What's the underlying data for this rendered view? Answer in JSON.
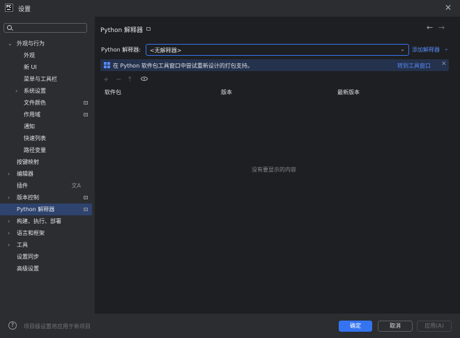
{
  "window": {
    "title": "设置",
    "app_icon_text": "PC"
  },
  "search": {
    "placeholder": "",
    "value": ""
  },
  "sidebar": {
    "items": [
      {
        "label": "外观与行为",
        "expanded": true
      },
      {
        "label": "外观"
      },
      {
        "label": "新 UI"
      },
      {
        "label": "菜单与工具栏"
      },
      {
        "label": "系统设置",
        "expandable": true
      },
      {
        "label": "文件颜色"
      },
      {
        "label": "作用域"
      },
      {
        "label": "通知"
      },
      {
        "label": "快速列表"
      },
      {
        "label": "路径变量"
      },
      {
        "label": "按键映射"
      },
      {
        "label": "编辑器",
        "expandable": true
      },
      {
        "label": "插件"
      },
      {
        "label": "版本控制",
        "expandable": true
      },
      {
        "label": "Python 解释器",
        "selected": true
      },
      {
        "label": "构建、执行、部署",
        "expandable": true
      },
      {
        "label": "语言和框架",
        "expandable": true
      },
      {
        "label": "工具",
        "expandable": true
      },
      {
        "label": "设置同步"
      },
      {
        "label": "高级设置"
      }
    ]
  },
  "main": {
    "title": "Python 解释器",
    "interpreter_label": "Python 解释器:",
    "interpreter_value": "<无解释器>",
    "add_interpreter": "添加解释器",
    "banner": {
      "text": "在 Python 软件包工具窗口中尝试重新设计的打包支持。",
      "link": "转到工具窗口"
    },
    "table": {
      "columns": [
        "软件包",
        "版本",
        "最新版本"
      ],
      "empty_text": "没有要显示的内容"
    }
  },
  "footer": {
    "note": "项目级设置将应用于新项目",
    "ok": "确定",
    "cancel": "取消",
    "apply": "应用(A)"
  },
  "colors": {
    "accent": "#3574f0",
    "link": "#548af7",
    "selection": "#2e436e",
    "sidebar_bg": "#2b2d30",
    "content_bg": "#1e1f22",
    "banner_bg": "#25324d"
  }
}
